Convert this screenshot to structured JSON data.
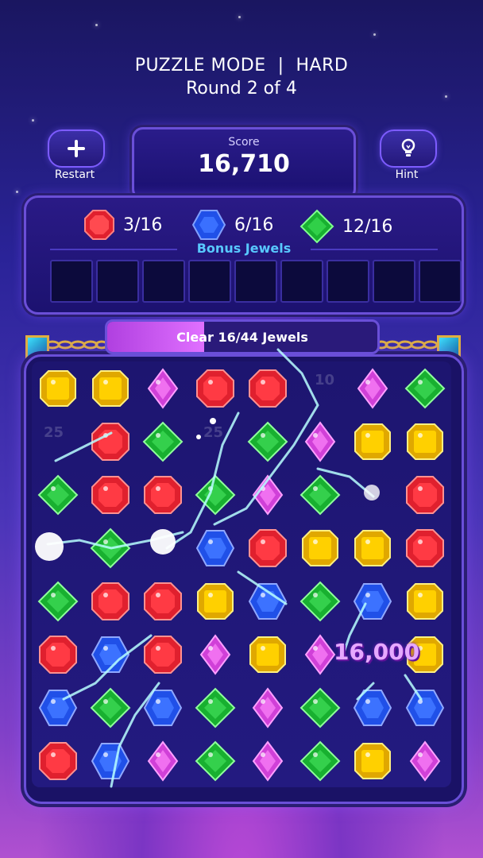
{
  "header": {
    "mode": "PUZZLE MODE  |  HARD",
    "round": "Round 2 of 4"
  },
  "restart": {
    "label": "Restart",
    "icon": "plus-icon"
  },
  "hint": {
    "label": "Hint",
    "icon": "lightbulb-icon"
  },
  "score": {
    "label": "Score",
    "value": "16,710"
  },
  "goals": [
    {
      "gem": "red",
      "text": "3/16"
    },
    {
      "gem": "blue",
      "text": "6/16"
    },
    {
      "gem": "green",
      "text": "12/16"
    }
  ],
  "bonus": {
    "label": "Bonus Jewels",
    "slots": 9
  },
  "progress": {
    "text": "Clear 16/44 Jewels",
    "fraction": 0.36
  },
  "ghost_scores": [
    "25",
    "25",
    "10"
  ],
  "popup": "16,000",
  "colors": {
    "red": "#e0202e",
    "blue": "#2050e8",
    "green": "#18b030",
    "yellow": "#ffd000",
    "purple": "#d040d8",
    "accent": "#6a4fd8"
  },
  "board": [
    [
      "yellow",
      "yellow",
      "purple",
      "red",
      "red",
      "",
      "purple",
      "green"
    ],
    [
      "",
      "red",
      "green",
      "",
      "green",
      "purple",
      "yellow",
      "yellow"
    ],
    [
      "green",
      "red",
      "red",
      "green",
      "purple",
      "green",
      "",
      "red"
    ],
    [
      "",
      "green",
      "",
      "blue",
      "red",
      "yellow",
      "yellow",
      "red"
    ],
    [
      "green",
      "red",
      "red",
      "yellow",
      "blue",
      "green",
      "blue",
      "yellow"
    ],
    [
      "red",
      "blue",
      "red",
      "purple",
      "yellow",
      "purple",
      "",
      "yellow"
    ],
    [
      "blue",
      "green",
      "blue",
      "green",
      "purple",
      "green",
      "blue",
      "blue"
    ],
    [
      "red",
      "blue",
      "purple",
      "green",
      "purple",
      "green",
      "yellow",
      "purple"
    ]
  ]
}
